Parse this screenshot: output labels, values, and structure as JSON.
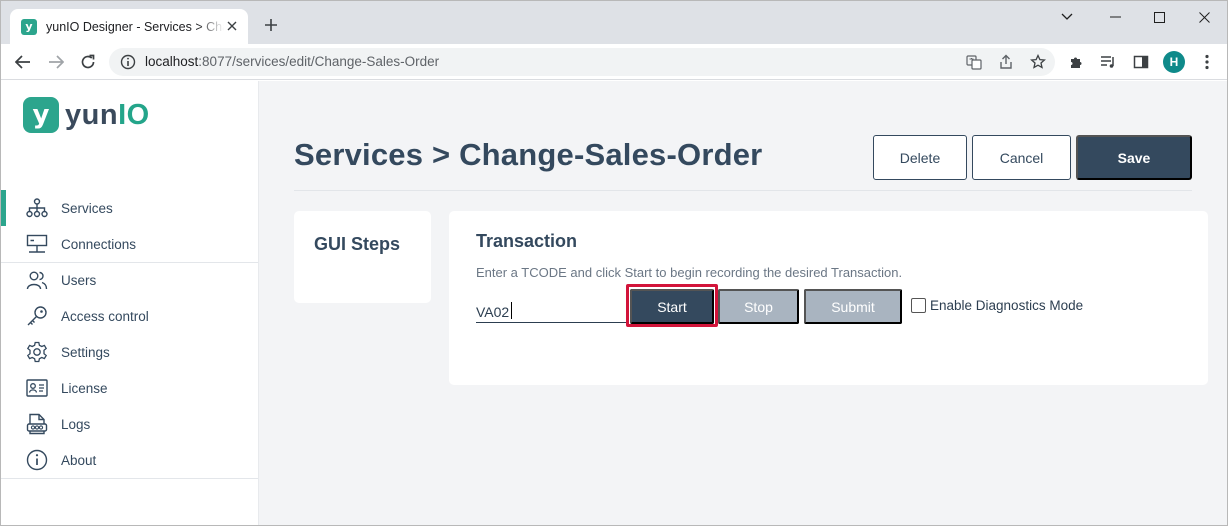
{
  "browser": {
    "tab_title": "yunIO Designer - Services > Change-Sales-Order",
    "tab_favicon_letter": "y",
    "url_host": "localhost",
    "url_path": ":8077/services/edit/Change-Sales-Order",
    "profile_initial": "H"
  },
  "app": {
    "logo_mark": "y",
    "logo_text_a": "yun",
    "logo_text_b": "IO",
    "brand_color": "#2ca58d",
    "primary_color": "#34495e"
  },
  "sidebar": {
    "items": [
      {
        "label": "Services",
        "icon": "sitemap-icon",
        "active": true
      },
      {
        "label": "Connections",
        "icon": "network-icon",
        "active": false
      },
      {
        "label": "Users",
        "icon": "users-icon",
        "active": false
      },
      {
        "label": "Access control",
        "icon": "key-icon",
        "active": false
      },
      {
        "label": "Settings",
        "icon": "gear-icon",
        "active": false
      },
      {
        "label": "License",
        "icon": "id-card-icon",
        "active": false
      },
      {
        "label": "Logs",
        "icon": "log-file-icon",
        "active": false
      },
      {
        "label": "About",
        "icon": "info-icon",
        "active": false
      }
    ]
  },
  "header": {
    "title": "Services > Change-Sales-Order",
    "delete_label": "Delete",
    "cancel_label": "Cancel",
    "save_label": "Save"
  },
  "steps_panel": {
    "title": "GUI Steps"
  },
  "transaction": {
    "title": "Transaction",
    "description": "Enter a TCODE and click Start to begin recording the desired Transaction.",
    "tcode_value": "VA02",
    "start_label": "Start",
    "stop_label": "Stop",
    "submit_label": "Submit",
    "diagnostics_label": "Enable Diagnostics Mode",
    "diagnostics_checked": false
  }
}
